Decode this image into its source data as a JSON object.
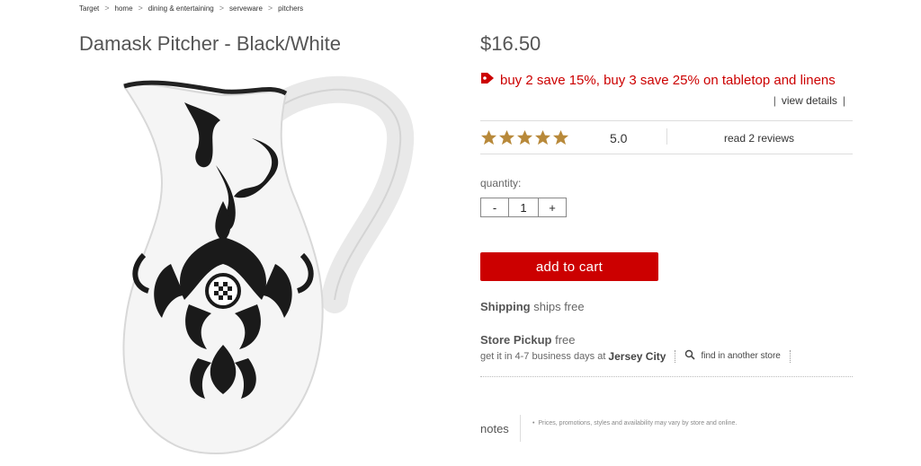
{
  "breadcrumb": [
    "Target",
    "home",
    "dining & entertaining",
    "serveware",
    "pitchers"
  ],
  "breadcrumb_separator": ">",
  "product": {
    "title": "Damask Pitcher - Black/White",
    "price": "$16.50",
    "promo": "buy 2 save 15%, buy 3 save 25% on tabletop and linens",
    "view_details": "view details",
    "rating_value": "5.0",
    "star_count": 5,
    "reviews_link": "read 2 reviews",
    "image_icon": "damask-pitcher-image"
  },
  "quantity": {
    "label": "quantity:",
    "minus": "-",
    "value": "1",
    "plus": "+"
  },
  "add_to_cart": "add to cart",
  "shipping": {
    "label": "Shipping",
    "text": "ships free"
  },
  "pickup": {
    "label": "Store Pickup",
    "text": "free",
    "line_prefix": "get it in 4-7 business days at",
    "store": "Jersey City",
    "find_link": "find in another store"
  },
  "notes": {
    "label": "notes",
    "text": "Prices, promotions, styles and availability may vary by store and online."
  },
  "colors": {
    "accent_red": "#cc0000",
    "star_gold": "#b8893a"
  }
}
